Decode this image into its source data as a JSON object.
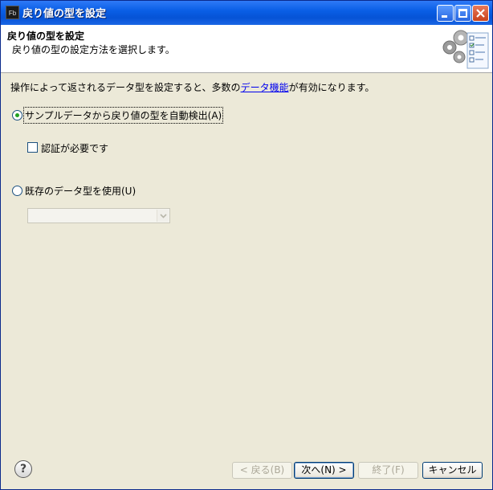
{
  "window": {
    "title": "戻り値の型を設定",
    "app_icon_text": "Fb"
  },
  "header": {
    "title": "戻り値の型を設定",
    "description": "戻り値の型の設定方法を選択します。"
  },
  "body": {
    "info_before": "操作によって返されるデータ型を設定すると、多数の",
    "info_link": "データ機能",
    "info_after": "が有効になります。",
    "option_auto": {
      "label": "サンプルデータから戻り値の型を自動検出(A)",
      "selected": true
    },
    "checkbox_auth": {
      "label": "認証が必要です",
      "checked": false
    },
    "option_existing": {
      "label": "既存のデータ型を使用(U)",
      "selected": false
    },
    "combo_value": ""
  },
  "footer": {
    "help_symbol": "?",
    "back_label": "< 戻る(B)",
    "next_label": "次へ(N) >",
    "finish_label": "終了(F)",
    "cancel_label": "キャンセル"
  },
  "colors": {
    "titlebar": "#0653d6",
    "dialog_bg": "#ece9d8",
    "radio_dot": "#21a121",
    "link": "#0000ee"
  }
}
